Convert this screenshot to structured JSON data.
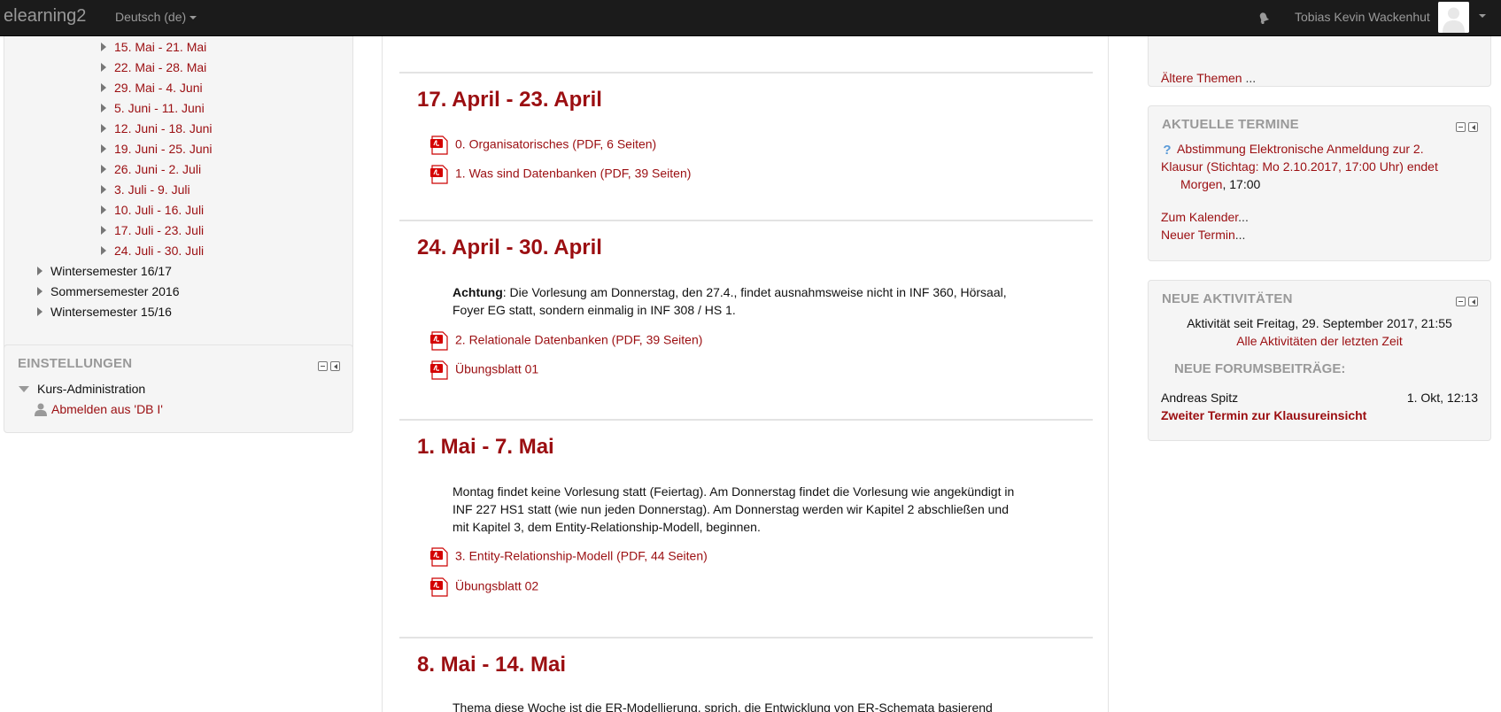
{
  "navbar": {
    "brand": "elearning2",
    "language": "Deutsch (de)",
    "user_name": "Tobias Kevin Wackenhut"
  },
  "nav_block": {
    "week_items": [
      {
        "label": "15. Mai - 21. Mai"
      },
      {
        "label": "22. Mai - 28. Mai"
      },
      {
        "label": "29. Mai - 4. Juni"
      },
      {
        "label": "5. Juni - 11. Juni"
      },
      {
        "label": "12. Juni - 18. Juni"
      },
      {
        "label": "19. Juni - 25. Juni"
      },
      {
        "label": "26. Juni - 2. Juli"
      },
      {
        "label": "3. Juli - 9. Juli"
      },
      {
        "label": "10. Juli - 16. Juli"
      },
      {
        "label": "17. Juli - 23. Juli"
      },
      {
        "label": "24. Juli - 30. Juli"
      }
    ],
    "semester_items": [
      {
        "label": "Wintersemester 16/17"
      },
      {
        "label": "Sommersemester 2016"
      },
      {
        "label": "Wintersemester 15/16"
      }
    ]
  },
  "settings_block": {
    "title": "EINSTELLUNGEN",
    "course_admin": "Kurs-Administration",
    "unenrol": "Abmelden aus 'DB I'"
  },
  "sections": [
    {
      "title": "17. April - 23. April",
      "summary_bold": "",
      "summary": "",
      "activities": [
        {
          "label": "0. Organisatorisches (PDF, 6 Seiten)"
        },
        {
          "label": "1. Was sind Datenbanken (PDF, 39 Seiten)"
        }
      ]
    },
    {
      "title": "24. April - 30. April",
      "summary_bold": "Achtung",
      "summary": ": Die Vorlesung am Donnerstag, den 27.4., findet ausnahmsweise nicht in INF 360, Hörsaal, Foyer EG statt, sondern einmalig in INF 308 / HS 1.",
      "activities": [
        {
          "label": "2. Relationale Datenbanken (PDF, 39 Seiten)"
        },
        {
          "label": "Übungsblatt 01"
        }
      ]
    },
    {
      "title": "1. Mai - 7. Mai",
      "summary_bold": "",
      "summary": "Montag findet keine Vorlesung statt (Feiertag). Am Donnerstag findet die Vorlesung wie angekündigt in INF 227 HS1 statt (wie nun jeden Donnerstag). Am Donnerstag werden wir Kapitel 2 abschließen und mit Kapitel 3, dem Entity-Relationship-Modell, beginnen.",
      "activities": [
        {
          "label": "3. Entity-Relationship-Modell (PDF, 44 Seiten)"
        },
        {
          "label": "Übungsblatt 02"
        }
      ]
    },
    {
      "title": "8. Mai - 14. Mai",
      "summary_bold": "",
      "summary": "Thema diese Woche ist die ER-Modellierung, sprich, die Entwicklung von ER-Schemata basierend",
      "activities": []
    }
  ],
  "older_topics": {
    "link": "Ältere Themen",
    "suffix": " ..."
  },
  "events_block": {
    "title": "AKTUELLE TERMINE",
    "event_link": "Abstimmung Elektronische Anmeldung zur 2. Klausur (Stichtag: Mo 2.10.2017, 17:00 Uhr) endet",
    "event_link_line1": "Abstimmung Elektronische Anmeldung zur 2.",
    "event_link_line2": "Klausur (Stichtag: Mo 2.10.2017, 17:00 Uhr) endet",
    "event_when_link": "Morgen",
    "event_when_time": ", 17:00",
    "calendar_link": "Zum Kalender",
    "new_event_link": "Neuer Termin",
    "ellipsis": "..."
  },
  "activity_block": {
    "title": "NEUE AKTIVITÄTEN",
    "since": "Aktivität seit Freitag, 29. September 2017, 21:55",
    "all_link": "Alle Aktivitäten der letzten Zeit",
    "forum_heading": "NEUE FORUMSBEITRÄGE:",
    "post_author": "Andreas Spitz",
    "post_date": "1. Okt, 12:13",
    "post_title": "Zweiter Termin zur Klausureinsicht"
  }
}
